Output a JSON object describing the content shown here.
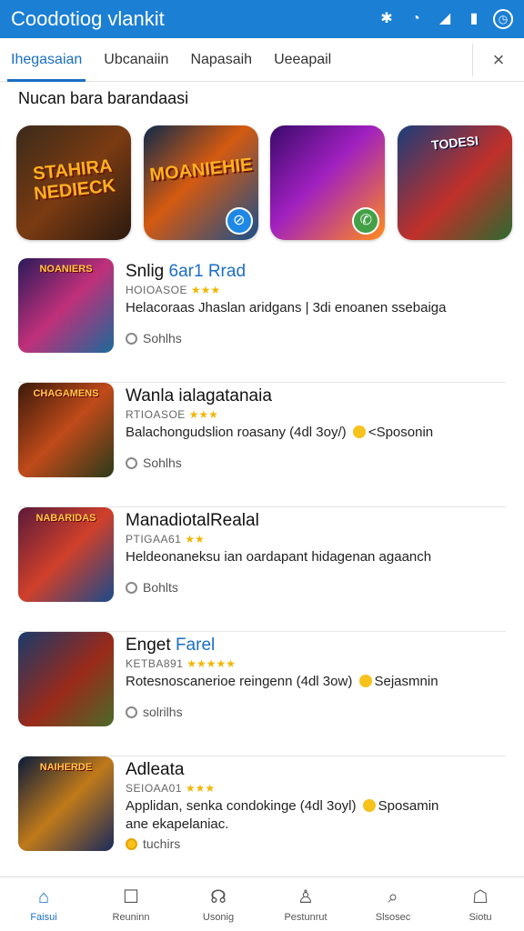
{
  "appbar": {
    "title": "Coodotiog vlankit",
    "status_icons": [
      "bluetooth-icon",
      "wifi-icon",
      "signal-icon",
      "battery-icon",
      "clock-icon"
    ],
    "color": "#1b7fd4"
  },
  "tabs": [
    {
      "label": "Ihegasaian",
      "active": true
    },
    {
      "label": "Ubcanaiin",
      "active": false
    },
    {
      "label": "Napasaih",
      "active": false
    },
    {
      "label": "Ueeapail",
      "active": false
    }
  ],
  "close_icon": "×",
  "section_title": "Nucan bara barandaasi",
  "featured": [
    {
      "text": "STAHIRA NEDIECK",
      "bg": "linear-gradient(135deg,#3a2a1a,#7a3b12 50%,#2b1a10)",
      "badge": ""
    },
    {
      "text": "MOANIEHIE",
      "bg": "linear-gradient(135deg,#0e2a4a,#d45a10 45%,#1b4f8a)",
      "badge": "⊘"
    },
    {
      "text": "",
      "bg": "linear-gradient(135deg,#3a0a6a,#a020c0 45%,#ff8c1a)",
      "badge": "✆"
    },
    {
      "text": "TODESI",
      "bg": "linear-gradient(135deg,#1b3d7a,#c0302a 55%,#2b6a30)",
      "badge": ""
    }
  ],
  "list": [
    {
      "name_main": "Snlig ",
      "name_hl": "6ar1 Rrad",
      "thumb_text": "NOANIERS",
      "thumb_bg": "linear-gradient(135deg,#2a1a5a,#c0307a 50%,#1a6a9a)",
      "meta_code": "HOIOASOE",
      "stars": "★★★",
      "desc": "Helacoraas Jhaslan aridgans | 3di enoanen ssebaiga",
      "desc2": "",
      "coin_text": "",
      "badge": "Sohlhs",
      "badge_gold": false
    },
    {
      "name_main": "Wanla ialagatanaia",
      "name_hl": "",
      "thumb_text": "CHAGAMENS",
      "thumb_bg": "linear-gradient(135deg,#3a1a0a,#c04a1a 50%,#2a3a1a)",
      "meta_code": "RTIOASOE",
      "stars": "★★★",
      "desc": "Balachongudslion roasany (4dl 3oy/)",
      "desc2": "",
      "coin_text": "<Sposonin",
      "badge": "Sohlhs",
      "badge_gold": false
    },
    {
      "name_main": "ManadiotalRealal",
      "name_hl": "",
      "thumb_text": "NABARIDAS",
      "thumb_bg": "linear-gradient(135deg,#5a1a3a,#d0402a 50%,#1a4a8a)",
      "meta_code": "PTIGAA61",
      "stars": "★★",
      "desc": "Heldeonaneksu ian oardapant hidagenan agaanch",
      "desc2": "",
      "coin_text": "",
      "badge": "Bohlts",
      "badge_gold": false
    },
    {
      "name_main": "Enget ",
      "name_hl": "Farel",
      "thumb_text": "",
      "thumb_bg": "linear-gradient(135deg,#1a3a6a,#9a2a1a 55%,#4a6a2a)",
      "meta_code": "KETBA891",
      "stars": "★★★★★",
      "desc": "Rotesnoscanerioe reingenn (4dl 3ow)",
      "desc2": "",
      "coin_text": "Sejasmnin",
      "badge": "solrilhs",
      "badge_gold": false
    },
    {
      "name_main": "Adleata",
      "name_hl": "",
      "thumb_text": "NAIHERDE",
      "thumb_bg": "linear-gradient(135deg,#0a1a3a,#c07a1a 50%,#1a2a5a)",
      "meta_code": "SEIOAA01",
      "stars": "★★★",
      "desc": "Applidan, senka condokinge (4dl 3oyl)",
      "desc2": "ane ekapelaniac.",
      "coin_text": "Sposamin",
      "badge": "tuchirs",
      "badge_gold": true
    }
  ],
  "bottom_nav": [
    {
      "label": "Faisui",
      "icon": "home-icon",
      "glyph": "⌂",
      "active": true
    },
    {
      "label": "Reuninn",
      "icon": "message-icon",
      "glyph": "☐",
      "active": false
    },
    {
      "label": "Usonig",
      "icon": "headset-icon",
      "glyph": "☊",
      "active": false
    },
    {
      "label": "Pestunrut",
      "icon": "person-icon",
      "glyph": "♙",
      "active": false
    },
    {
      "label": "Slsosec",
      "icon": "search-icon",
      "glyph": "⌕",
      "active": false
    },
    {
      "label": "Siotu",
      "icon": "inbox-icon",
      "glyph": "☖",
      "active": false
    }
  ]
}
